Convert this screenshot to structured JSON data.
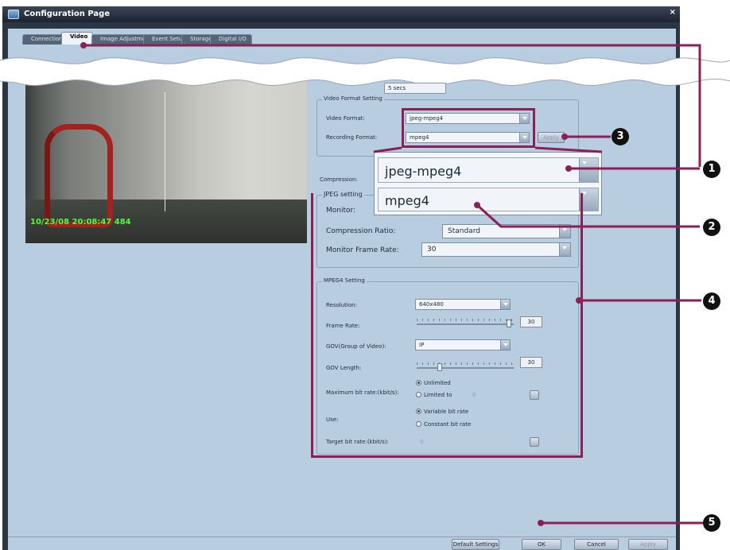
{
  "window": {
    "title": "Configuration Page",
    "close_glyph": "×"
  },
  "tabs": [
    {
      "label": "Connection"
    },
    {
      "label": "Video"
    },
    {
      "label": "Image Adjustment"
    },
    {
      "label": "Event Setup"
    },
    {
      "label": "Storage"
    },
    {
      "label": "Digital I/O"
    }
  ],
  "preview": {
    "timestamp": "10/23/08 20:08:47 484",
    "interval": "5 secs"
  },
  "video_format_setting": {
    "legend": "Video Format Setting",
    "video_format_label": "Video Format:",
    "video_format_value": "jpeg-mpeg4",
    "recording_format_label": "Recording Format:",
    "recording_format_value": "mpeg4",
    "apply_label": "Apply"
  },
  "compression_label": "Compression:",
  "zoom_callout": {
    "video_format_value": "jpeg-mpeg4",
    "recording_format_value": "mpeg4"
  },
  "jpeg_setting": {
    "legend": "JPEG setting",
    "monitor_label": "Monitor:",
    "compression_ratio_label": "Compression Ratio:",
    "compression_ratio_value": "Standard",
    "monitor_frame_rate_label": "Monitor Frame Rate:",
    "monitor_frame_rate_value": "30"
  },
  "mpeg4_setting": {
    "legend": "MPEG4 Setting",
    "resolution_label": "Resolution:",
    "resolution_value": "640x480",
    "frame_rate_label": "Frame Rate:",
    "frame_rate_value": "30",
    "frame_rate_fraction": 0.97,
    "gov_label": "GOV(Group of Video):",
    "gov_value": "IP",
    "gov_length_label": "GOV Length:",
    "gov_length_value": "30",
    "gov_length_fraction": 0.22,
    "max_bitrate_label": "Maximum bit rate:(kbit/s):",
    "unlimited_label": "Unlimited",
    "limited_to_label": "Limited to",
    "limited_to_value": "0",
    "use_label": "Use:",
    "variable_label": "Variable bit rate",
    "constant_label": "Constant bit rate",
    "target_bitrate_label": "Target bit rate:(kbit/s):",
    "target_bitrate_value": "0"
  },
  "buttons": {
    "default_settings": "Default Settings",
    "ok": "OK",
    "cancel": "Cancel",
    "apply": "Apply"
  },
  "callouts": [
    {
      "number": "1"
    },
    {
      "number": "2"
    },
    {
      "number": "3"
    },
    {
      "number": "4"
    },
    {
      "number": "5"
    }
  ],
  "colors": {
    "callout": "#8b1f58",
    "timestamp": "#4cff3a",
    "panel": "#b9cde1",
    "frame": "#2b3645"
  }
}
